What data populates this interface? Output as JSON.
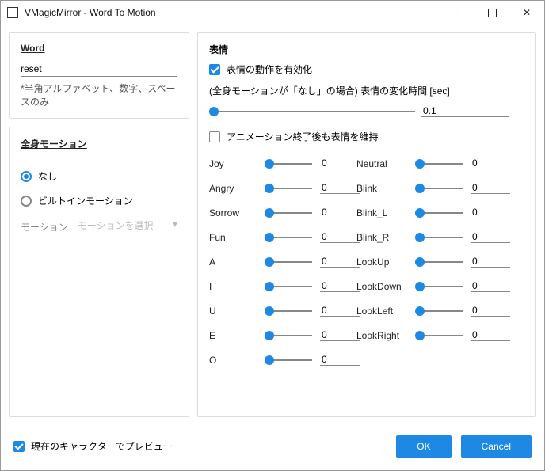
{
  "window": {
    "title": "VMagicMirror - Word To Motion"
  },
  "left": {
    "word": {
      "title": "Word",
      "value": "reset",
      "helper": "*半角アルファベット、数字、スペースのみ"
    },
    "motion": {
      "title": "全身モーション",
      "opt_none": "なし",
      "opt_builtin": "ビルトインモーション",
      "selected": "none",
      "dropdown_label": "モーション",
      "dropdown_placeholder": "モーションを選択"
    }
  },
  "right": {
    "title": "表情",
    "enable_label": "表情の動作を有効化",
    "enable_checked": true,
    "time_label": "(全身モーションが「なし」の場合) 表情の変化時間 [sec]",
    "time_value": "0.1",
    "keep_label": "アニメーション終了後も表情を維持",
    "keep_checked": false,
    "params_left": [
      {
        "name": "Joy",
        "value": "0"
      },
      {
        "name": "Angry",
        "value": "0"
      },
      {
        "name": "Sorrow",
        "value": "0"
      },
      {
        "name": "Fun",
        "value": "0"
      },
      {
        "name": "A",
        "value": "0"
      },
      {
        "name": "I",
        "value": "0"
      },
      {
        "name": "U",
        "value": "0"
      },
      {
        "name": "E",
        "value": "0"
      },
      {
        "name": "O",
        "value": "0"
      }
    ],
    "params_right": [
      {
        "name": "Neutral",
        "value": "0"
      },
      {
        "name": "Blink",
        "value": "0"
      },
      {
        "name": "Blink_L",
        "value": "0"
      },
      {
        "name": "Blink_R",
        "value": "0"
      },
      {
        "name": "LookUp",
        "value": "0"
      },
      {
        "name": "LookDown",
        "value": "0"
      },
      {
        "name": "LookLeft",
        "value": "0"
      },
      {
        "name": "LookRight",
        "value": "0"
      }
    ]
  },
  "footer": {
    "preview_label": "現在のキャラクターでプレビュー",
    "preview_checked": true,
    "ok": "OK",
    "cancel": "Cancel"
  }
}
